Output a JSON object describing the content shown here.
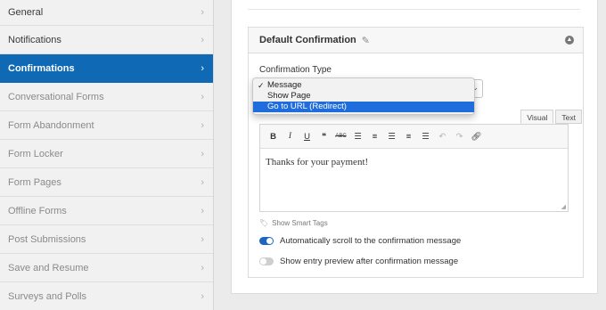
{
  "sidebar": {
    "items": [
      {
        "label": "General"
      },
      {
        "label": "Notifications"
      },
      {
        "label": "Confirmations"
      },
      {
        "label": "Conversational Forms"
      },
      {
        "label": "Form Abandonment"
      },
      {
        "label": "Form Locker"
      },
      {
        "label": "Form Pages"
      },
      {
        "label": "Offline Forms"
      },
      {
        "label": "Post Submissions"
      },
      {
        "label": "Save and Resume"
      },
      {
        "label": "Surveys and Polls"
      }
    ],
    "active_color": "#0f69b4"
  },
  "panel": {
    "title": "Default Confirmation",
    "confirmation_type_label": "Confirmation Type",
    "dropdown_options": [
      "Message",
      "Show Page",
      "Go to URL (Redirect)"
    ],
    "checked_option": "Message",
    "highlighted_option": "Go to URL (Redirect)",
    "editor_tabs": [
      "Visual",
      "Text"
    ],
    "active_tab": "Visual",
    "editor_text": "Thanks for your payment!",
    "smart_tags_label": "Show Smart Tags",
    "toggles": [
      {
        "label": "Automatically scroll to the confirmation message",
        "on": true
      },
      {
        "label": "Show entry preview after confirmation message",
        "on": false
      }
    ]
  },
  "icons": {
    "pencil": "pencil-icon",
    "collapse": "chevron-up-icon",
    "tag": "tag-icon"
  }
}
